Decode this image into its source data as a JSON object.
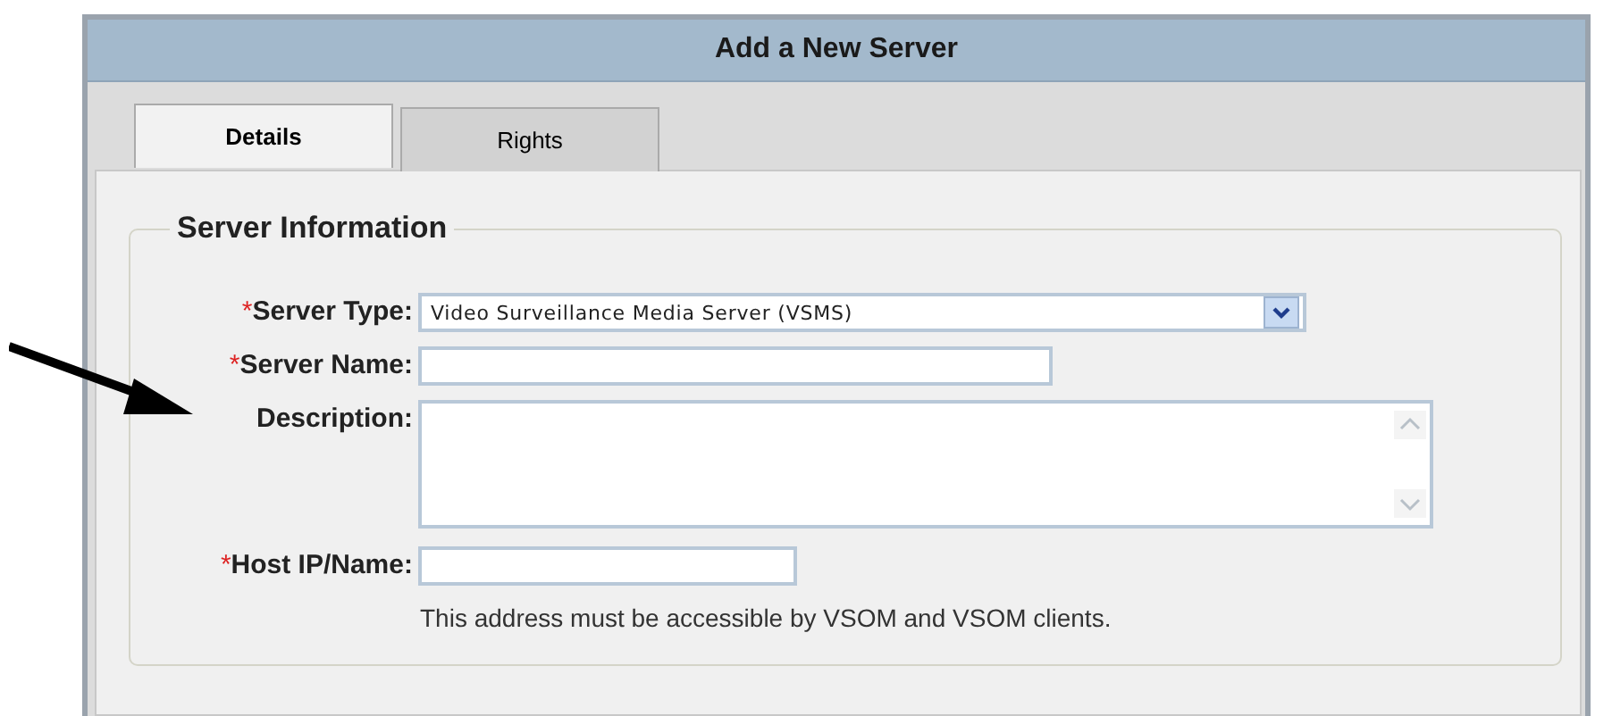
{
  "window": {
    "title": "Add a New Server"
  },
  "tabs": [
    {
      "label": "Details",
      "selected": true
    },
    {
      "label": "Rights",
      "selected": false
    }
  ],
  "section": {
    "legend": "Server Information",
    "fields": [
      {
        "kind": "select",
        "label": "Server Type:",
        "required_mark": "*",
        "value": "Video Surveillance Media Server (VSMS)"
      },
      {
        "kind": "text",
        "label": "Server Name:",
        "required_mark": "*"
      },
      {
        "kind": "textarea",
        "label": "Description:"
      },
      {
        "kind": "text",
        "label": "Host IP/Name:",
        "required_mark": "*",
        "hint": "This address must be accessible by VSOM and VSOM clients."
      }
    ]
  }
}
